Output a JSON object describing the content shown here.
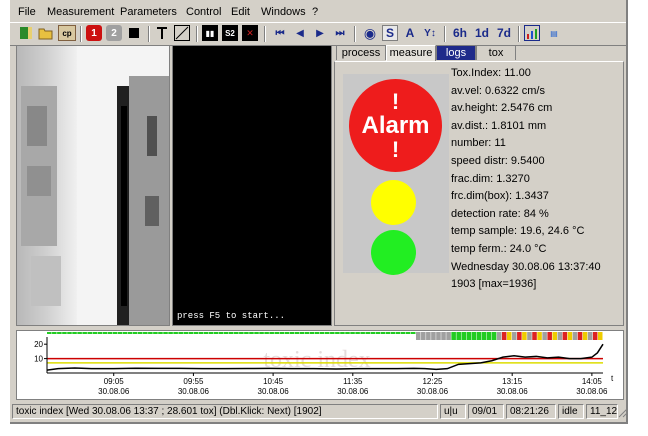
{
  "menu": [
    "File",
    "Measurement",
    "Parameters",
    "Control",
    "Edit",
    "Windows",
    "?"
  ],
  "toolbar_text": {
    "s": "S",
    "a": "A",
    "h6": "6h",
    "d1": "1d",
    "d7": "7d"
  },
  "video_hint": "press F5 to start...",
  "tabs": [
    "process",
    "measure",
    "logs",
    "tox"
  ],
  "alarm": {
    "ex": "!",
    "word": "Alarm"
  },
  "metrics": [
    "Tox.Index: 11.00",
    "av.vel: 0.6322 cm/s",
    "av.height: 2.5476 cm",
    "av.dist.:  1.8101 mm",
    "number:     11",
    "speed distr: 9.5400",
    "frac.dim: 1.3270",
    "frc.dim(box):  1.3437",
    "detection rate:  84 %",
    "temp sample:  19.6, 24.6 °C",
    "temp ferm.:  24.0 °C",
    "Wednesday 30.08.06 13:37:40",
    "1903 [max=1936]"
  ],
  "chart_data": {
    "type": "line",
    "watermark": "toxic index",
    "y_ticks": [
      "20",
      "10"
    ],
    "ylim": [
      0,
      25
    ],
    "x_axis_label": "t",
    "x_ticks": [
      {
        "time": "09:05",
        "date": "30.08.06"
      },
      {
        "time": "09:55",
        "date": "30.08.06"
      },
      {
        "time": "10:45",
        "date": "30.08.06"
      },
      {
        "time": "11:35",
        "date": "30.08.06"
      },
      {
        "time": "12:25",
        "date": "30.08.06"
      },
      {
        "time": "13:15",
        "date": "30.08.06"
      },
      {
        "time": "14:05",
        "date": "30.08.06"
      }
    ],
    "thresholds": [
      {
        "value": 10,
        "color": "#cc0000"
      },
      {
        "value": 7,
        "color": "#dddd00"
      }
    ],
    "series": [
      {
        "color": "#000000",
        "x": [
          0,
          0.02,
          0.05,
          0.08,
          0.12,
          0.16,
          0.2,
          0.24,
          0.28,
          0.32,
          0.36,
          0.4,
          0.44,
          0.48,
          0.52,
          0.56,
          0.6,
          0.63,
          0.66,
          0.68,
          0.7,
          0.72,
          0.74,
          0.76,
          0.78,
          0.8,
          0.82,
          0.84,
          0.86,
          0.88,
          0.9,
          0.92,
          0.94,
          0.96,
          0.98,
          0.99,
          1.0
        ],
        "y": [
          2,
          3,
          3.5,
          3,
          3,
          3.3,
          3.2,
          3.2,
          3,
          3,
          3.1,
          3.2,
          3,
          3,
          2.8,
          3,
          3,
          3,
          3.2,
          3,
          2.5,
          3,
          6,
          6.5,
          7,
          8.5,
          11,
          12,
          11,
          11.5,
          10.5,
          11,
          10,
          10,
          11,
          14,
          20
        ]
      }
    ]
  },
  "status": {
    "main": "toxic index [Wed 30.08.06 13:37 ;  28.601 tox]  (Dbl.Klick: Next) [1902]",
    "mode": "u|u",
    "date": "09/01",
    "time": "08:21:26",
    "state": "idle",
    "code": "11_12"
  },
  "colors": {
    "alarm": "#ee1c1c",
    "warn": "#ffff00",
    "ok": "#22ee22",
    "logs_tab": "#1f2a8a"
  }
}
